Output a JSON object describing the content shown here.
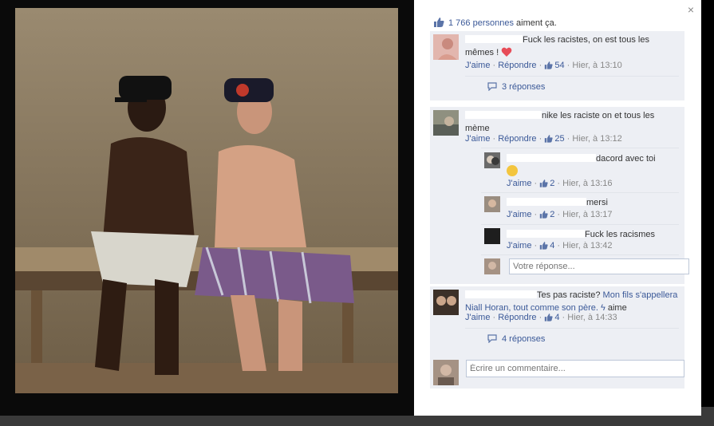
{
  "likes": {
    "count_text": "1 766 personnes",
    "suffix": " aiment ça."
  },
  "close_label": "×",
  "comments": [
    {
      "text": "Fuck les racistes, on est tous les mêmes !",
      "like": "J'aime",
      "reply": "Répondre",
      "likes": "54",
      "time": "Hier, à 13:10",
      "replies": "3 réponses"
    },
    {
      "text": "nike les raciste on et tous les mème",
      "like": "J'aime",
      "reply": "Répondre",
      "likes": "25",
      "time": "Hier, à 13:12",
      "subreplies": [
        {
          "text": "dacord avec toi",
          "like": "J'aime",
          "likes": "2",
          "time": "Hier, à 13:16"
        },
        {
          "text": "mersi",
          "like": "J'aime",
          "likes": "2",
          "time": "Hier, à 13:17"
        },
        {
          "text": "Fuck les racismes",
          "like": "J'aime",
          "likes": "4",
          "time": "Hier, à 13:42"
        }
      ],
      "reply_placeholder": "Votre réponse..."
    },
    {
      "text_prefix": "Tes pas raciste? ",
      "text_link": "Mon fils s'appellera Niall Horan, tout comme son père.",
      "text_suffix": " aime",
      "like": "J'aime",
      "reply": "Répondre",
      "likes": "4",
      "time": "Hier, à 14:33",
      "replies": "4 réponses"
    }
  ],
  "comment_placeholder": "Écrire un commentaire..."
}
